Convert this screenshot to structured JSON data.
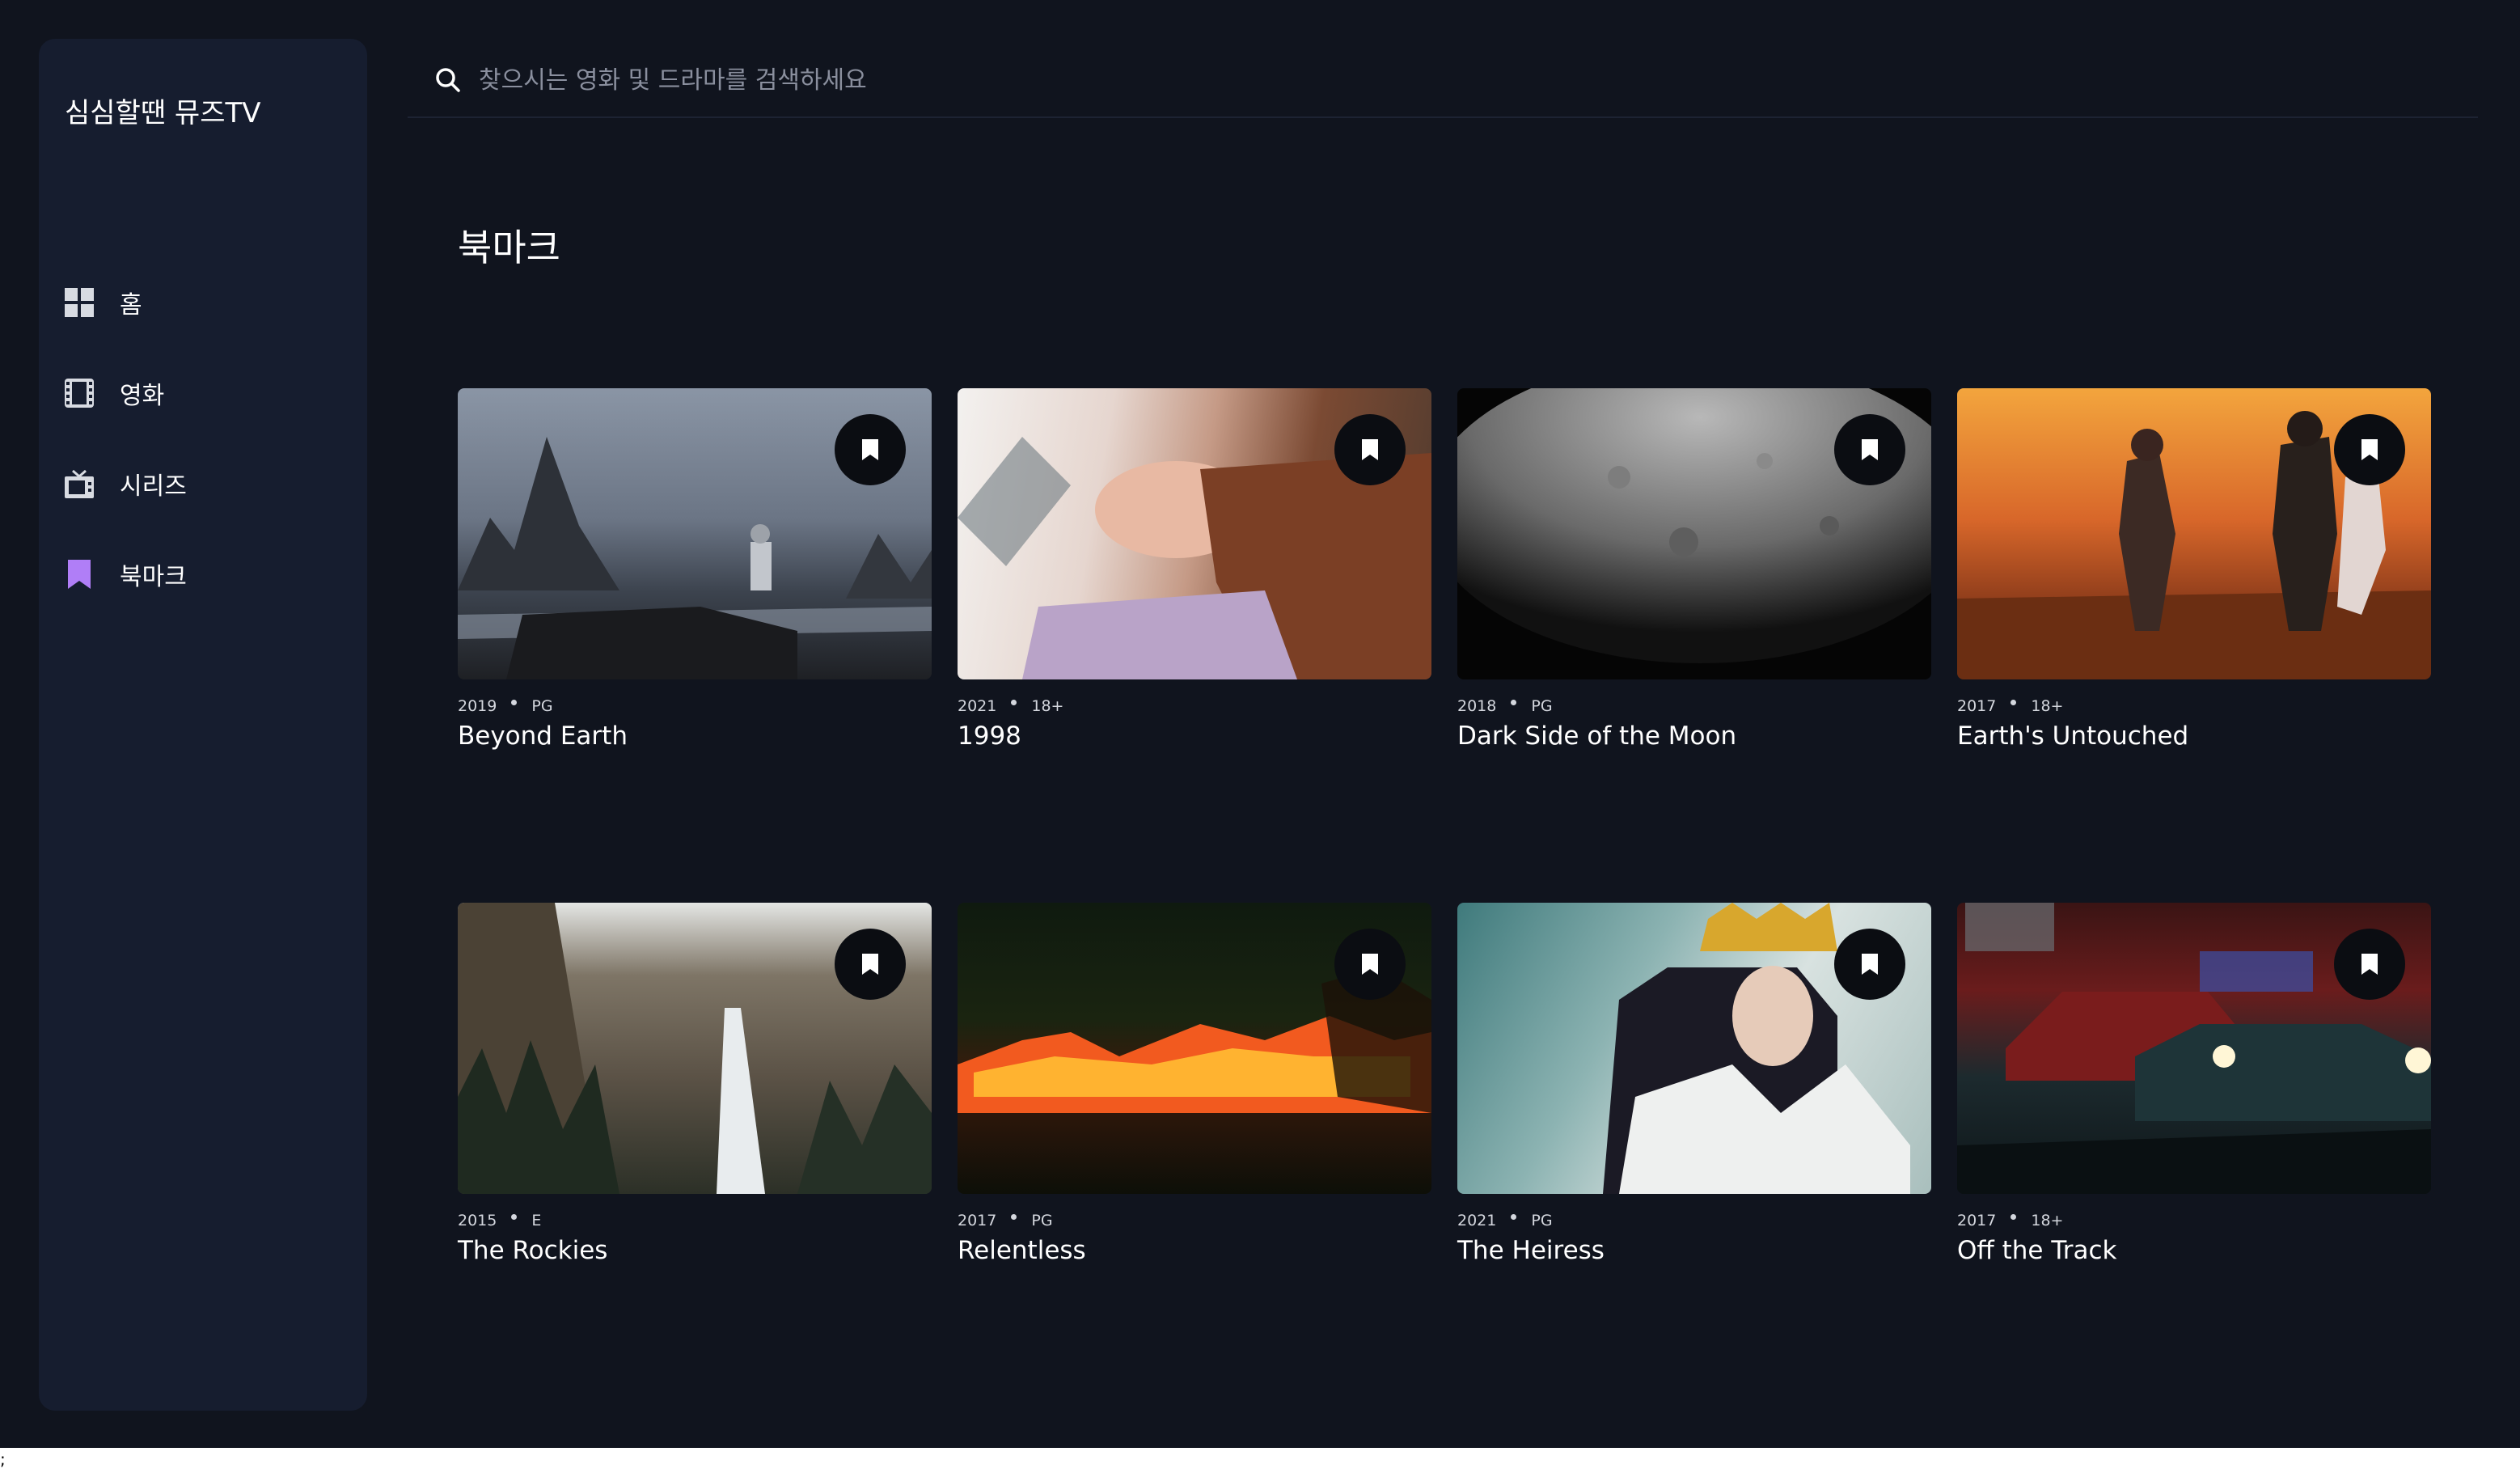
{
  "app": {
    "brand": "심심할땐 뮤즈TV"
  },
  "sidebar": {
    "items": [
      {
        "label": "홈",
        "icon": "grid-icon",
        "active": false
      },
      {
        "label": "영화",
        "icon": "film-icon",
        "active": false
      },
      {
        "label": "시리즈",
        "icon": "tv-icon",
        "active": false
      },
      {
        "label": "북마크",
        "icon": "bookmark-icon",
        "active": true
      }
    ]
  },
  "colors": {
    "background": "#10141e",
    "sidebar": "#161d2f",
    "accent": "#b07ef7",
    "text": "#ffffff"
  },
  "search": {
    "placeholder": "찾으시는 영화 및 드라마를 검색하세요",
    "value": ""
  },
  "main": {
    "title": "북마크",
    "cards": [
      {
        "year": "2019",
        "rating": "PG",
        "title": "Beyond Earth",
        "bookmarked": true
      },
      {
        "year": "2021",
        "rating": "18+",
        "title": "1998",
        "bookmarked": true
      },
      {
        "year": "2018",
        "rating": "PG",
        "title": "Dark Side of the Moon",
        "bookmarked": true
      },
      {
        "year": "2017",
        "rating": "18+",
        "title": "Earth's Untouched",
        "bookmarked": true
      },
      {
        "year": "2015",
        "rating": "E",
        "title": "The Rockies",
        "bookmarked": true
      },
      {
        "year": "2017",
        "rating": "PG",
        "title": "Relentless",
        "bookmarked": true
      },
      {
        "year": "2021",
        "rating": "PG",
        "title": "The Heiress",
        "bookmarked": true
      },
      {
        "year": "2017",
        "rating": "18+",
        "title": "Off the Track",
        "bookmarked": true
      }
    ]
  },
  "footer_artifact": ";"
}
